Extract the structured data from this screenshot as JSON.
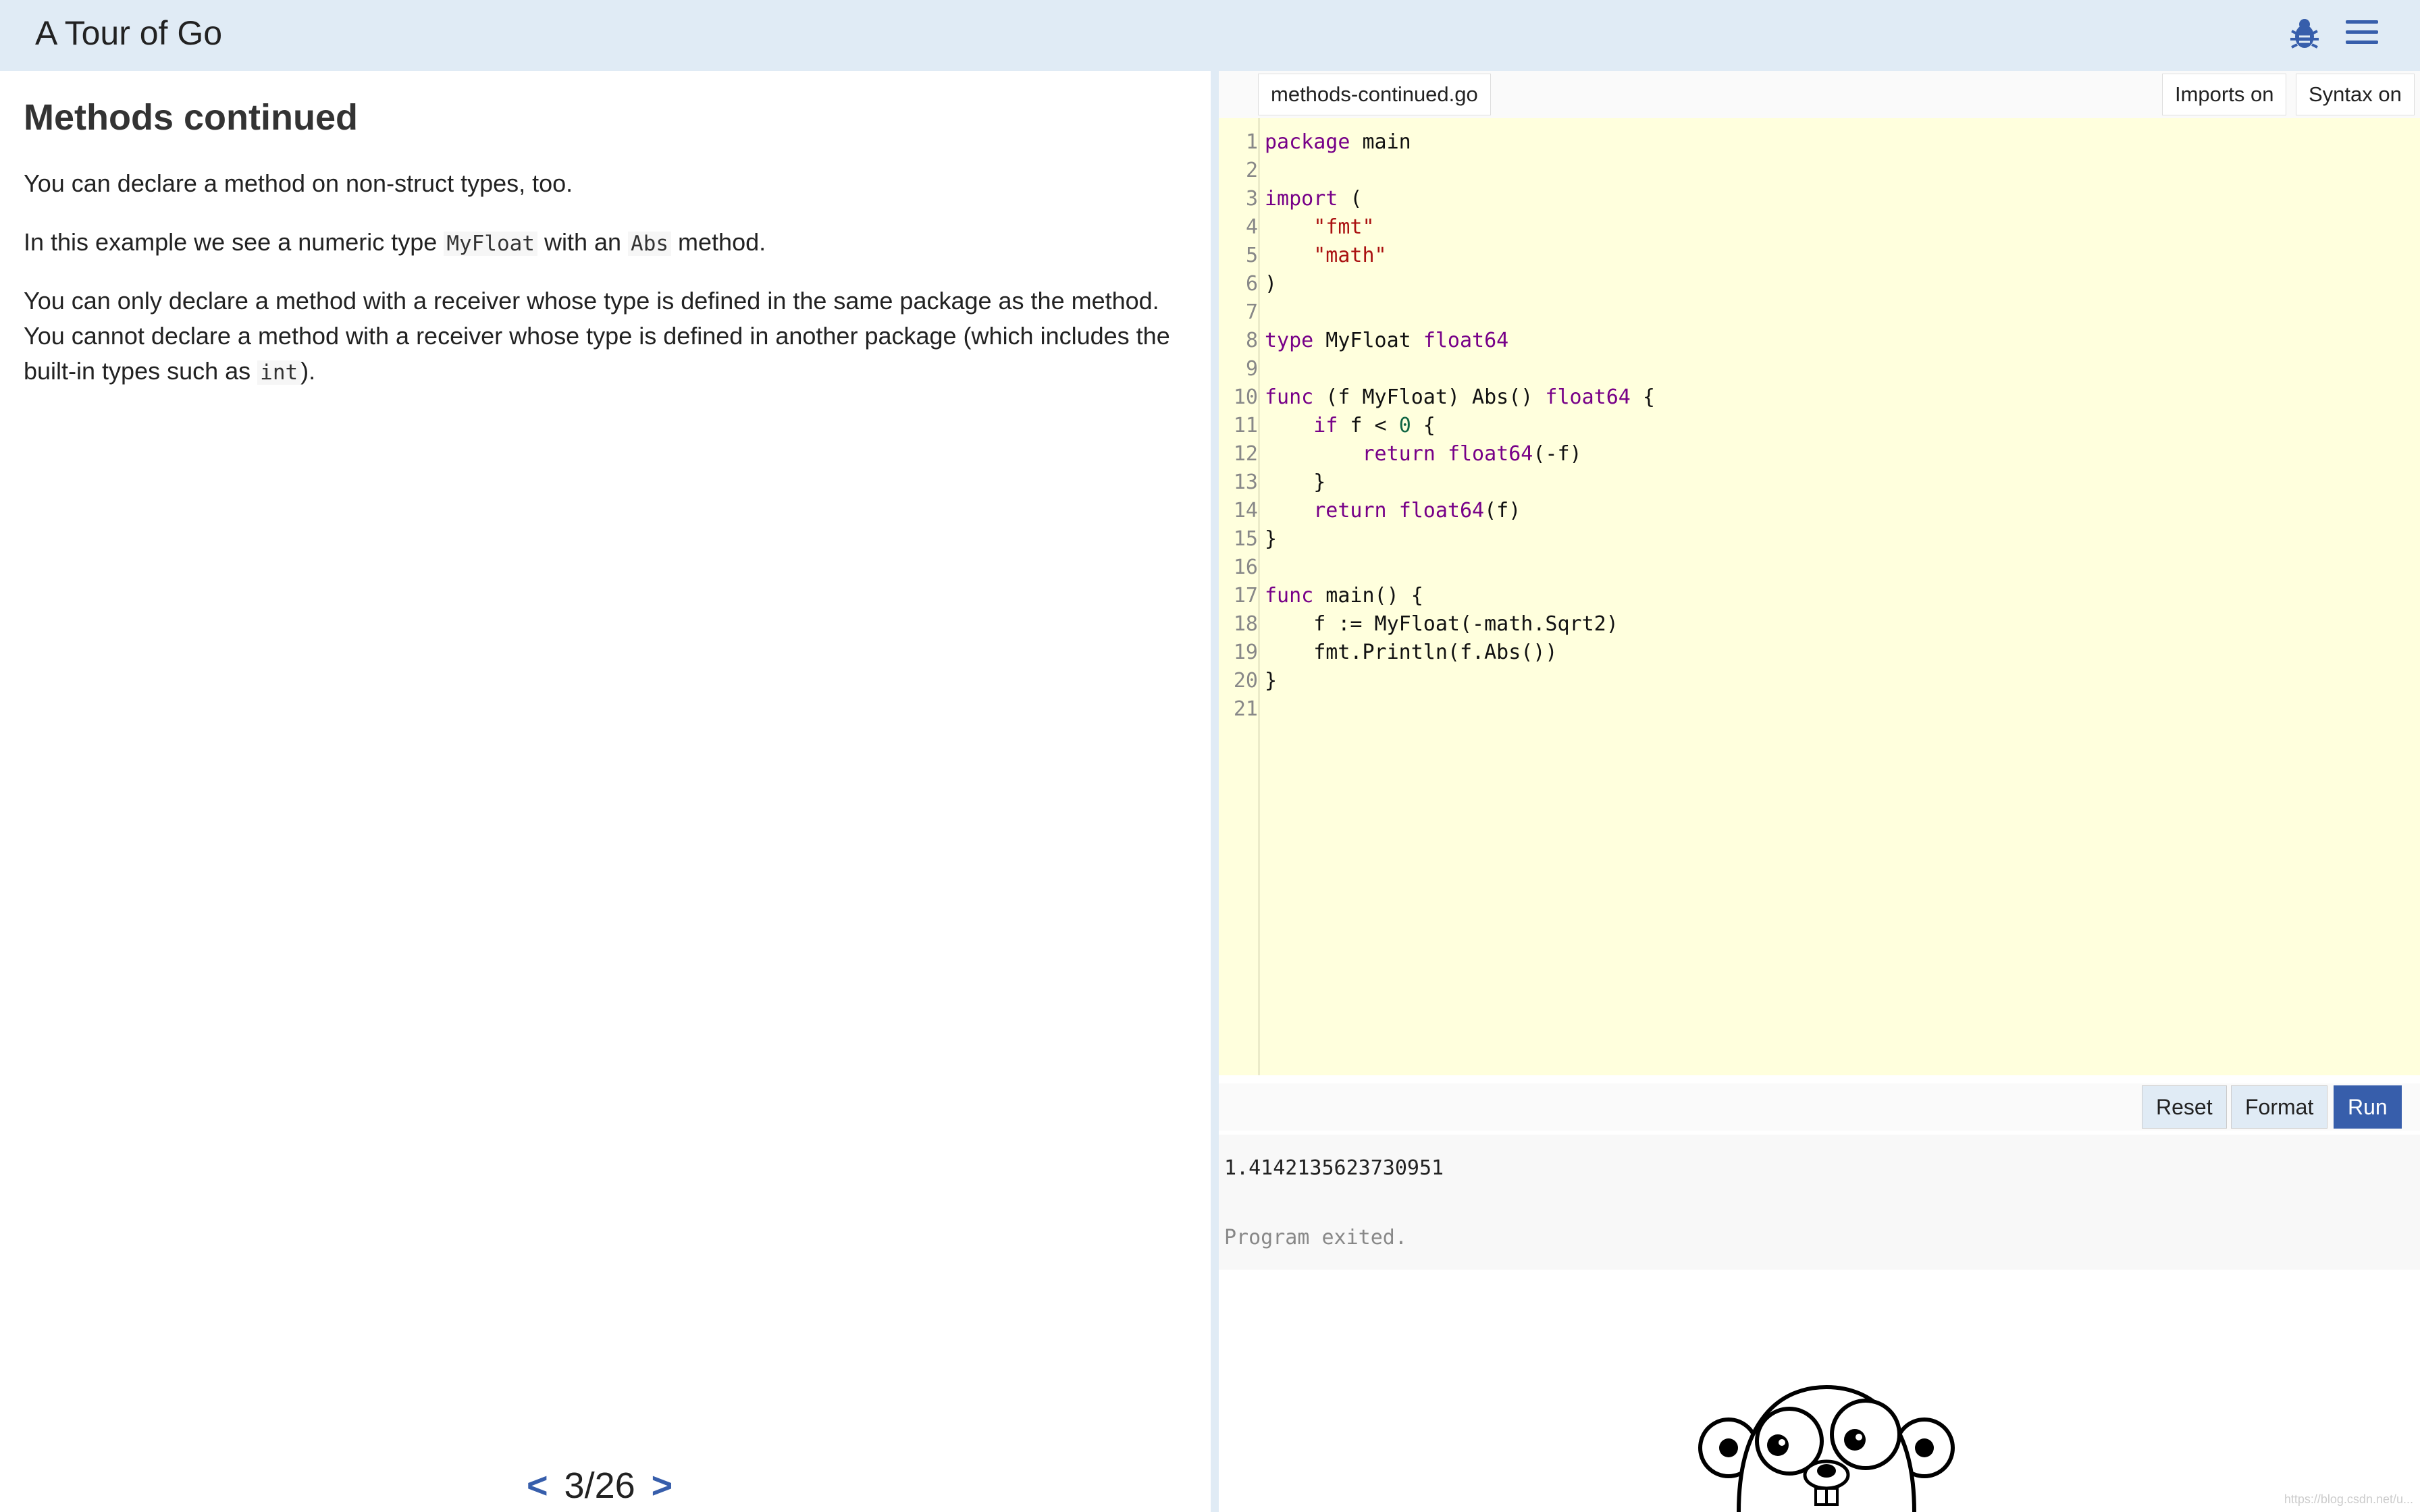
{
  "header": {
    "title": "A Tour of Go",
    "bug_icon": "bug-icon",
    "menu_icon": "hamburger-menu-icon"
  },
  "lesson": {
    "title": "Methods continued",
    "p1": "You can declare a method on non-struct types, too.",
    "p2_a": "In this example we see a numeric type ",
    "p2_code1": "MyFloat",
    "p2_b": " with an ",
    "p2_code2": "Abs",
    "p2_c": " method.",
    "p3_a": "You can only declare a method with a receiver whose type is defined in the same package as the method. You cannot declare a method with a receiver whose type is defined in another package (which includes the built-in types such as ",
    "p3_code": "int",
    "p3_b": ")."
  },
  "pager": {
    "prev": "<",
    "count": "3/26",
    "next": ">"
  },
  "editor": {
    "filename": "methods-continued.go",
    "imports_toggle": "Imports on",
    "syntax_toggle": "Syntax on",
    "line_numbers": [
      "1",
      "2",
      "3",
      "4",
      "5",
      "6",
      "7",
      "8",
      "9",
      "10",
      "11",
      "12",
      "13",
      "14",
      "15",
      "16",
      "17",
      "18",
      "19",
      "20",
      "21"
    ],
    "code_lines": [
      "package main",
      "",
      "import (",
      "    \"fmt\"",
      "    \"math\"",
      ")",
      "",
      "type MyFloat float64",
      "",
      "func (f MyFloat) Abs() float64 {",
      "    if f < 0 {",
      "        return float64(-f)",
      "    }",
      "    return float64(f)",
      "}",
      "",
      "func main() {",
      "    f := MyFloat(-math.Sqrt2)",
      "    fmt.Println(f.Abs())",
      "}",
      ""
    ]
  },
  "actions": {
    "reset": "Reset",
    "format": "Format",
    "run": "Run"
  },
  "output": {
    "result": "1.4142135623730951",
    "status": "Program exited."
  },
  "watermark": "https://blog.csdn.net/u..."
}
